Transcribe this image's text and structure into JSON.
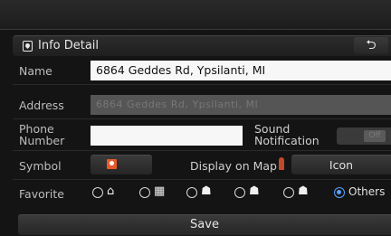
{
  "header": {
    "title": "Info Detail",
    "back_glyph": "⮌"
  },
  "form": {
    "name_label": "Name",
    "name_value": "6864 Geddes Rd, Ypsilanti, MI",
    "address_label": "Address",
    "address_value": "6864 Geddes Rd, Ypsilanti, MI",
    "phone_label_1": "Phone",
    "phone_label_2": "Number",
    "phone_value": "",
    "sound_label_1": "Sound",
    "sound_label_2": "Notification",
    "sound_toggle": "Off",
    "symbol_label": "Symbol",
    "display_label": "Display on Map",
    "display_value": "Icon",
    "favorite_label": "Favorite",
    "favorite_options": [
      {
        "icon": "home-icon",
        "glyph": "⌂",
        "selected": false
      },
      {
        "icon": "office-icon",
        "glyph": "▦",
        "selected": false
      },
      {
        "icon": "person-icon-1",
        "glyph": "☗",
        "selected": false
      },
      {
        "icon": "person-icon-2",
        "glyph": "☗",
        "selected": false
      },
      {
        "icon": "person-icon-3",
        "glyph": "☗",
        "selected": false
      },
      {
        "label": "Others",
        "selected": true
      }
    ]
  },
  "save_label": "Save",
  "colors": {
    "accent": "#5aa0ff",
    "symbol": "#e85a2a",
    "background": "#141414"
  }
}
